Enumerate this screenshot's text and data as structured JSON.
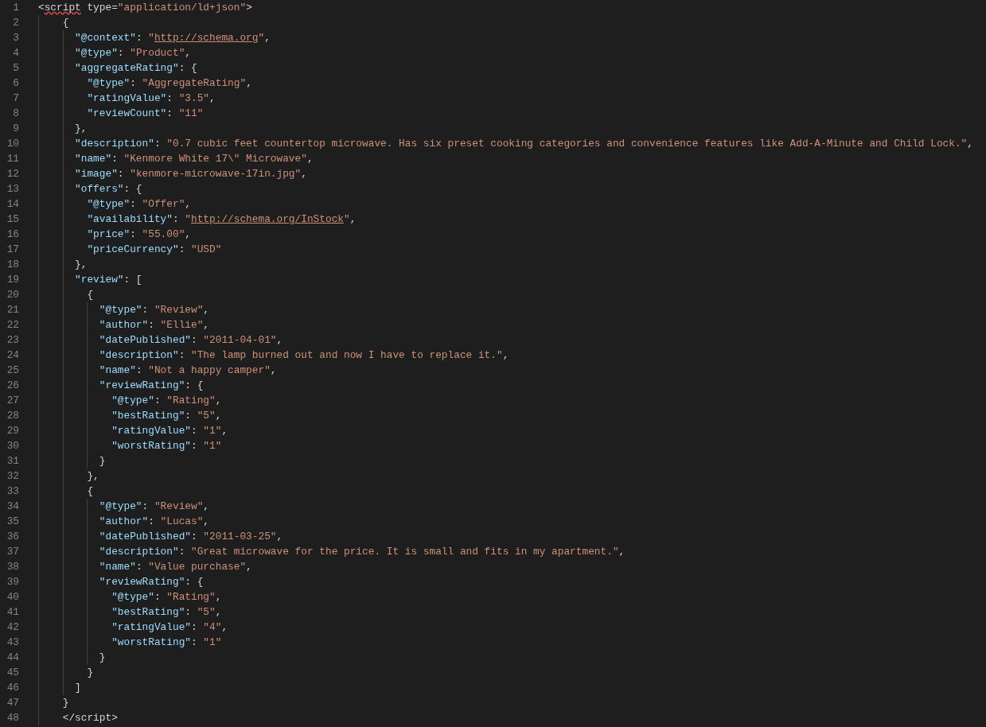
{
  "editor": {
    "lines": [
      {
        "number": "1",
        "tokens": [
          {
            "kind": "punct",
            "text": "<"
          },
          {
            "kind": "tag-error",
            "text": "script"
          },
          {
            "kind": "punct",
            "text": " type="
          },
          {
            "kind": "string",
            "text": "\"application/ld+json\""
          },
          {
            "kind": "punct",
            "text": ">"
          }
        ]
      },
      {
        "number": "2",
        "tokens": [
          {
            "kind": "punct",
            "text": "    {"
          }
        ]
      },
      {
        "number": "3",
        "tokens": [
          {
            "kind": "key",
            "text": "      \"@context\""
          },
          {
            "kind": "punct",
            "text": ": "
          },
          {
            "kind": "string",
            "text": "\""
          },
          {
            "kind": "link",
            "text": "http://schema.org"
          },
          {
            "kind": "string",
            "text": "\""
          },
          {
            "kind": "punct",
            "text": ","
          }
        ]
      },
      {
        "number": "4",
        "tokens": [
          {
            "kind": "key",
            "text": "      \"@type\""
          },
          {
            "kind": "punct",
            "text": ": "
          },
          {
            "kind": "string",
            "text": "\"Product\""
          },
          {
            "kind": "punct",
            "text": ","
          }
        ]
      },
      {
        "number": "5",
        "tokens": [
          {
            "kind": "key",
            "text": "      \"aggregateRating\""
          },
          {
            "kind": "punct",
            "text": ": {"
          }
        ]
      },
      {
        "number": "6",
        "tokens": [
          {
            "kind": "key",
            "text": "        \"@type\""
          },
          {
            "kind": "punct",
            "text": ": "
          },
          {
            "kind": "string",
            "text": "\"AggregateRating\""
          },
          {
            "kind": "punct",
            "text": ","
          }
        ]
      },
      {
        "number": "7",
        "tokens": [
          {
            "kind": "key",
            "text": "        \"ratingValue\""
          },
          {
            "kind": "punct",
            "text": ": "
          },
          {
            "kind": "string",
            "text": "\"3.5\""
          },
          {
            "kind": "punct",
            "text": ","
          }
        ]
      },
      {
        "number": "8",
        "tokens": [
          {
            "kind": "key",
            "text": "        \"reviewCount\""
          },
          {
            "kind": "punct",
            "text": ": "
          },
          {
            "kind": "string",
            "text": "\"11\""
          }
        ]
      },
      {
        "number": "9",
        "tokens": [
          {
            "kind": "punct",
            "text": "      },"
          }
        ]
      },
      {
        "number": "10",
        "tokens": [
          {
            "kind": "key",
            "text": "      \"description\""
          },
          {
            "kind": "punct",
            "text": ": "
          },
          {
            "kind": "string",
            "text": "\"0.7 cubic feet countertop microwave. Has six preset cooking categories and convenience features like Add-A-Minute and Child Lock.\""
          },
          {
            "kind": "punct",
            "text": ","
          }
        ]
      },
      {
        "number": "11",
        "tokens": [
          {
            "kind": "key",
            "text": "      \"name\""
          },
          {
            "kind": "punct",
            "text": ": "
          },
          {
            "kind": "string",
            "text": "\"Kenmore White 17\\\" Microwave\""
          },
          {
            "kind": "punct",
            "text": ","
          }
        ]
      },
      {
        "number": "12",
        "tokens": [
          {
            "kind": "key",
            "text": "      \"image\""
          },
          {
            "kind": "punct",
            "text": ": "
          },
          {
            "kind": "string",
            "text": "\"kenmore-microwave-17in.jpg\""
          },
          {
            "kind": "punct",
            "text": ","
          }
        ]
      },
      {
        "number": "13",
        "tokens": [
          {
            "kind": "key",
            "text": "      \"offers\""
          },
          {
            "kind": "punct",
            "text": ": {"
          }
        ]
      },
      {
        "number": "14",
        "tokens": [
          {
            "kind": "key",
            "text": "        \"@type\""
          },
          {
            "kind": "punct",
            "text": ": "
          },
          {
            "kind": "string",
            "text": "\"Offer\""
          },
          {
            "kind": "punct",
            "text": ","
          }
        ]
      },
      {
        "number": "15",
        "tokens": [
          {
            "kind": "key",
            "text": "        \"availability\""
          },
          {
            "kind": "punct",
            "text": ": "
          },
          {
            "kind": "string",
            "text": "\""
          },
          {
            "kind": "link",
            "text": "http://schema.org/InStock"
          },
          {
            "kind": "string",
            "text": "\""
          },
          {
            "kind": "punct",
            "text": ","
          }
        ]
      },
      {
        "number": "16",
        "tokens": [
          {
            "kind": "key",
            "text": "        \"price\""
          },
          {
            "kind": "punct",
            "text": ": "
          },
          {
            "kind": "string",
            "text": "\"55.00\""
          },
          {
            "kind": "punct",
            "text": ","
          }
        ]
      },
      {
        "number": "17",
        "tokens": [
          {
            "kind": "key",
            "text": "        \"priceCurrency\""
          },
          {
            "kind": "punct",
            "text": ": "
          },
          {
            "kind": "string",
            "text": "\"USD\""
          }
        ]
      },
      {
        "number": "18",
        "tokens": [
          {
            "kind": "punct",
            "text": "      },"
          }
        ]
      },
      {
        "number": "19",
        "tokens": [
          {
            "kind": "key",
            "text": "      \"review\""
          },
          {
            "kind": "punct",
            "text": ": ["
          }
        ]
      },
      {
        "number": "20",
        "tokens": [
          {
            "kind": "punct",
            "text": "        {"
          }
        ]
      },
      {
        "number": "21",
        "tokens": [
          {
            "kind": "key",
            "text": "          \"@type\""
          },
          {
            "kind": "punct",
            "text": ": "
          },
          {
            "kind": "string",
            "text": "\"Review\""
          },
          {
            "kind": "punct",
            "text": ","
          }
        ]
      },
      {
        "number": "22",
        "tokens": [
          {
            "kind": "key",
            "text": "          \"author\""
          },
          {
            "kind": "punct",
            "text": ": "
          },
          {
            "kind": "string",
            "text": "\"Ellie\""
          },
          {
            "kind": "punct",
            "text": ","
          }
        ]
      },
      {
        "number": "23",
        "tokens": [
          {
            "kind": "key",
            "text": "          \"datePublished\""
          },
          {
            "kind": "punct",
            "text": ": "
          },
          {
            "kind": "string",
            "text": "\"2011-04-01\""
          },
          {
            "kind": "punct",
            "text": ","
          }
        ]
      },
      {
        "number": "24",
        "tokens": [
          {
            "kind": "key",
            "text": "          \"description\""
          },
          {
            "kind": "punct",
            "text": ": "
          },
          {
            "kind": "string",
            "text": "\"The lamp burned out and now I have to replace it.\""
          },
          {
            "kind": "punct",
            "text": ","
          }
        ]
      },
      {
        "number": "25",
        "tokens": [
          {
            "kind": "key",
            "text": "          \"name\""
          },
          {
            "kind": "punct",
            "text": ": "
          },
          {
            "kind": "string",
            "text": "\"Not a happy camper\""
          },
          {
            "kind": "punct",
            "text": ","
          }
        ]
      },
      {
        "number": "26",
        "tokens": [
          {
            "kind": "key",
            "text": "          \"reviewRating\""
          },
          {
            "kind": "punct",
            "text": ": {"
          }
        ]
      },
      {
        "number": "27",
        "tokens": [
          {
            "kind": "key",
            "text": "            \"@type\""
          },
          {
            "kind": "punct",
            "text": ": "
          },
          {
            "kind": "string",
            "text": "\"Rating\""
          },
          {
            "kind": "punct",
            "text": ","
          }
        ]
      },
      {
        "number": "28",
        "tokens": [
          {
            "kind": "key",
            "text": "            \"bestRating\""
          },
          {
            "kind": "punct",
            "text": ": "
          },
          {
            "kind": "string",
            "text": "\"5\""
          },
          {
            "kind": "punct",
            "text": ","
          }
        ]
      },
      {
        "number": "29",
        "tokens": [
          {
            "kind": "key",
            "text": "            \"ratingValue\""
          },
          {
            "kind": "punct",
            "text": ": "
          },
          {
            "kind": "string",
            "text": "\"1\""
          },
          {
            "kind": "punct",
            "text": ","
          }
        ]
      },
      {
        "number": "30",
        "tokens": [
          {
            "kind": "key",
            "text": "            \"worstRating\""
          },
          {
            "kind": "punct",
            "text": ": "
          },
          {
            "kind": "string",
            "text": "\"1\""
          }
        ]
      },
      {
        "number": "31",
        "tokens": [
          {
            "kind": "punct",
            "text": "          }"
          }
        ]
      },
      {
        "number": "32",
        "tokens": [
          {
            "kind": "punct",
            "text": "        },"
          }
        ]
      },
      {
        "number": "33",
        "tokens": [
          {
            "kind": "punct",
            "text": "        {"
          }
        ]
      },
      {
        "number": "34",
        "tokens": [
          {
            "kind": "key",
            "text": "          \"@type\""
          },
          {
            "kind": "punct",
            "text": ": "
          },
          {
            "kind": "string",
            "text": "\"Review\""
          },
          {
            "kind": "punct",
            "text": ","
          }
        ]
      },
      {
        "number": "35",
        "tokens": [
          {
            "kind": "key",
            "text": "          \"author\""
          },
          {
            "kind": "punct",
            "text": ": "
          },
          {
            "kind": "string",
            "text": "\"Lucas\""
          },
          {
            "kind": "punct",
            "text": ","
          }
        ]
      },
      {
        "number": "36",
        "tokens": [
          {
            "kind": "key",
            "text": "          \"datePublished\""
          },
          {
            "kind": "punct",
            "text": ": "
          },
          {
            "kind": "string",
            "text": "\"2011-03-25\""
          },
          {
            "kind": "punct",
            "text": ","
          }
        ]
      },
      {
        "number": "37",
        "tokens": [
          {
            "kind": "key",
            "text": "          \"description\""
          },
          {
            "kind": "punct",
            "text": ": "
          },
          {
            "kind": "string",
            "text": "\"Great microwave for the price. It is small and fits in my apartment.\""
          },
          {
            "kind": "punct",
            "text": ","
          }
        ]
      },
      {
        "number": "38",
        "tokens": [
          {
            "kind": "key",
            "text": "          \"name\""
          },
          {
            "kind": "punct",
            "text": ": "
          },
          {
            "kind": "string",
            "text": "\"Value purchase\""
          },
          {
            "kind": "punct",
            "text": ","
          }
        ]
      },
      {
        "number": "39",
        "tokens": [
          {
            "kind": "key",
            "text": "          \"reviewRating\""
          },
          {
            "kind": "punct",
            "text": ": {"
          }
        ]
      },
      {
        "number": "40",
        "tokens": [
          {
            "kind": "key",
            "text": "            \"@type\""
          },
          {
            "kind": "punct",
            "text": ": "
          },
          {
            "kind": "string",
            "text": "\"Rating\""
          },
          {
            "kind": "punct",
            "text": ","
          }
        ]
      },
      {
        "number": "41",
        "tokens": [
          {
            "kind": "key",
            "text": "            \"bestRating\""
          },
          {
            "kind": "punct",
            "text": ": "
          },
          {
            "kind": "string",
            "text": "\"5\""
          },
          {
            "kind": "punct",
            "text": ","
          }
        ]
      },
      {
        "number": "42",
        "tokens": [
          {
            "kind": "key",
            "text": "            \"ratingValue\""
          },
          {
            "kind": "punct",
            "text": ": "
          },
          {
            "kind": "string",
            "text": "\"4\""
          },
          {
            "kind": "punct",
            "text": ","
          }
        ]
      },
      {
        "number": "43",
        "tokens": [
          {
            "kind": "key",
            "text": "            \"worstRating\""
          },
          {
            "kind": "punct",
            "text": ": "
          },
          {
            "kind": "string",
            "text": "\"1\""
          }
        ]
      },
      {
        "number": "44",
        "tokens": [
          {
            "kind": "punct",
            "text": "          }"
          }
        ]
      },
      {
        "number": "45",
        "tokens": [
          {
            "kind": "punct",
            "text": "        }"
          }
        ]
      },
      {
        "number": "46",
        "tokens": [
          {
            "kind": "punct",
            "text": "      ]"
          }
        ]
      },
      {
        "number": "47",
        "tokens": [
          {
            "kind": "punct",
            "text": "    }"
          }
        ]
      },
      {
        "number": "48",
        "tokens": [
          {
            "kind": "punct",
            "text": "    </script>"
          }
        ]
      }
    ]
  }
}
